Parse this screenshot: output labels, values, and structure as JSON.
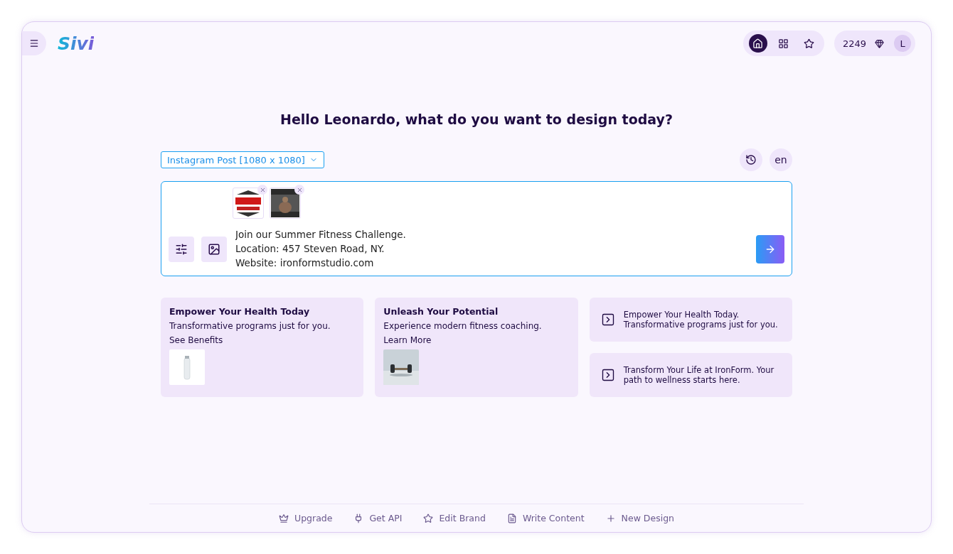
{
  "header": {
    "logo": "Sivi",
    "nav": [
      {
        "kind": "home",
        "selected": true
      },
      {
        "kind": "grid",
        "selected": false
      },
      {
        "kind": "star",
        "selected": false
      }
    ],
    "credits": "2249",
    "avatar": "L"
  },
  "greeting": "Hello Leonardo, what do you want to design today?",
  "format": "Instagram Post [1080 x 1080]",
  "language": "en",
  "prompt": {
    "value": "Join our Summer Fitness Challenge.\nLocation: 457 Steven Road, NY.\nWebsite: ironformstudio.com"
  },
  "image_cards": [
    {
      "title": "Empower Your Health Today",
      "text": "Transformative programs just for you.",
      "link": "See Benefits",
      "kind": "picture"
    },
    {
      "title": "Unleash Your Potential",
      "text": "Experience modern fitness coaching.",
      "link": "Learn More",
      "kind": "picture"
    }
  ],
  "text_cards": [
    {
      "text": "Empower Your Health Today. Transformative programs just for you."
    },
    {
      "text": "Transform Your Life at IronForm. Your path to wellness starts here."
    }
  ],
  "footer": [
    {
      "kind": "crown",
      "label": "Upgrade"
    },
    {
      "kind": "plug",
      "label": "Get API"
    },
    {
      "kind": "star",
      "label": "Edit Brand"
    },
    {
      "kind": "doc",
      "label": "Write Content"
    },
    {
      "kind": "plus",
      "label": "New Design"
    }
  ]
}
